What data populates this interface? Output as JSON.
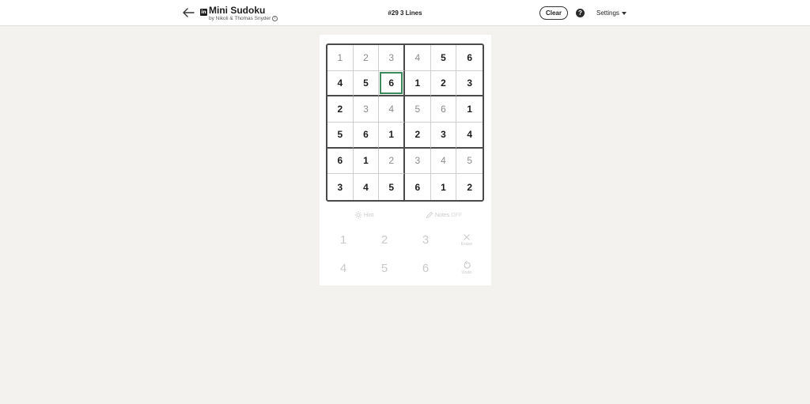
{
  "header": {
    "title": "Mini Sudoku",
    "byline": "by Nikoli & Thomas Snyder",
    "brand_icon_text": "in",
    "puzzle_name": "#29 3 Lines",
    "clear_label": "Clear",
    "help_label": "?",
    "settings_label": "Settings"
  },
  "board": {
    "selected": [
      1,
      2
    ],
    "rows": [
      [
        {
          "v": "1",
          "t": "filled"
        },
        {
          "v": "2",
          "t": "filled"
        },
        {
          "v": "3",
          "t": "filled"
        },
        {
          "v": "4",
          "t": "filled"
        },
        {
          "v": "5",
          "t": "given"
        },
        {
          "v": "6",
          "t": "given"
        }
      ],
      [
        {
          "v": "4",
          "t": "given"
        },
        {
          "v": "5",
          "t": "given"
        },
        {
          "v": "6",
          "t": "given"
        },
        {
          "v": "1",
          "t": "given"
        },
        {
          "v": "2",
          "t": "given"
        },
        {
          "v": "3",
          "t": "given"
        }
      ],
      [
        {
          "v": "2",
          "t": "given"
        },
        {
          "v": "3",
          "t": "filled"
        },
        {
          "v": "4",
          "t": "filled"
        },
        {
          "v": "5",
          "t": "filled"
        },
        {
          "v": "6",
          "t": "filled"
        },
        {
          "v": "1",
          "t": "given"
        }
      ],
      [
        {
          "v": "5",
          "t": "given"
        },
        {
          "v": "6",
          "t": "given"
        },
        {
          "v": "1",
          "t": "given"
        },
        {
          "v": "2",
          "t": "given"
        },
        {
          "v": "3",
          "t": "given"
        },
        {
          "v": "4",
          "t": "given"
        }
      ],
      [
        {
          "v": "6",
          "t": "given"
        },
        {
          "v": "1",
          "t": "given"
        },
        {
          "v": "2",
          "t": "filled"
        },
        {
          "v": "3",
          "t": "filled"
        },
        {
          "v": "4",
          "t": "filled"
        },
        {
          "v": "5",
          "t": "filled"
        }
      ],
      [
        {
          "v": "3",
          "t": "given"
        },
        {
          "v": "4",
          "t": "given"
        },
        {
          "v": "5",
          "t": "given"
        },
        {
          "v": "6",
          "t": "given"
        },
        {
          "v": "1",
          "t": "given"
        },
        {
          "v": "2",
          "t": "given"
        }
      ]
    ]
  },
  "tools": {
    "hint_label": "Hint",
    "notes_label": "Notes",
    "notes_state": "OFF"
  },
  "keypad": {
    "digits": [
      "1",
      "2",
      "3",
      "4",
      "5",
      "6"
    ],
    "erase_label": "Erase",
    "undo_label": "Undo"
  },
  "colors": {
    "selected_border": "#3c8a5c",
    "background": "#f3f2ef"
  }
}
